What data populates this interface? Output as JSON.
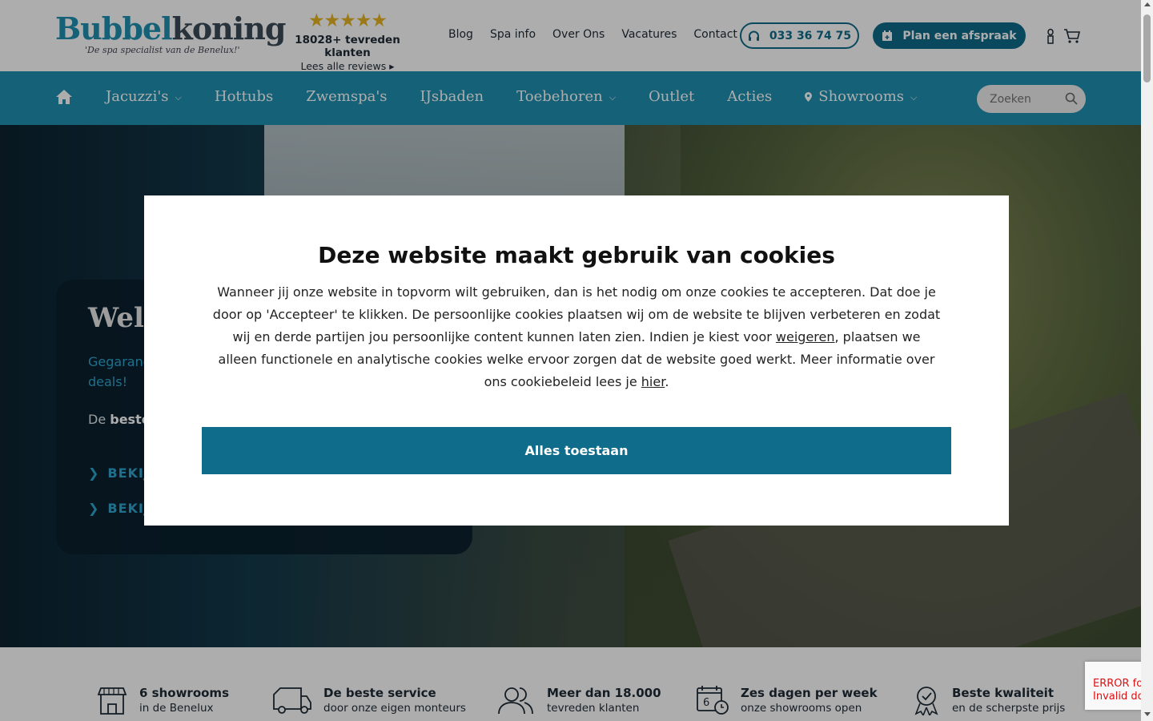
{
  "logo": {
    "part1": "Bubbel",
    "part2": "koning",
    "tagline": "'De spa specialist van de Benelux!'"
  },
  "reviews": {
    "stars": "★★★★★",
    "count": "18028+ tevreden klanten",
    "link": "Lees alle reviews ▸"
  },
  "topnav": [
    "Blog",
    "Spa info",
    "Over Ons",
    "Vacatures",
    "Contact"
  ],
  "phone": "033 36 74 75",
  "appointment": "Plan een afspraak",
  "mainnav": [
    {
      "label": "Jacuzzi's",
      "dropdown": true
    },
    {
      "label": "Hottubs",
      "dropdown": false
    },
    {
      "label": "Zwemspa's",
      "dropdown": false
    },
    {
      "label": "IJsbaden",
      "dropdown": false
    },
    {
      "label": "Toebehoren",
      "dropdown": true
    },
    {
      "label": "Outlet",
      "dropdown": false
    },
    {
      "label": "Acties",
      "dropdown": false
    },
    {
      "label": "Showrooms",
      "dropdown": true
    }
  ],
  "search": {
    "placeholder": "Zoeken"
  },
  "hero": {
    "title": "Welk",
    "subtitle": "Gegaranc",
    "subtitle2": "deals!",
    "text_prefix": "De ",
    "text_bold": "beste",
    "link1": "BEKIJK",
    "link2": "BEKIJK"
  },
  "cookie": {
    "title": "Deze website maakt gebruik van cookies",
    "text1": "Wanneer jij onze website in topvorm wilt gebruiken, dan is het nodig om onze cookies te accepteren. Dat doe je door op 'Accepteer' te klikken. De persoonlijke cookies plaatsen wij om de website te blijven verbeteren en zodat wij en derde partijen jou persoonlijke content kunnen laten zien. Indien je kiest voor ",
    "refuse_link": "weigeren",
    "text2": ", plaatsen we alleen functionele en analytische cookies welke ervoor zorgen dat de website goed werkt. Meer informatie over ons cookiebeleid lees je ",
    "here_link": "hier",
    "text3": ".",
    "accept": "Alles toestaan"
  },
  "features": [
    {
      "title": "6 showrooms",
      "sub": "in de Benelux",
      "icon": "store-icon"
    },
    {
      "title": "De beste service",
      "sub": "door onze eigen monteurs",
      "icon": "van-icon"
    },
    {
      "title": "Meer dan 18.000",
      "sub": "tevreden klanten",
      "icon": "people-icon"
    },
    {
      "title": "Zes dagen per week",
      "sub": "onze showrooms open",
      "icon": "calendar-icon"
    },
    {
      "title": "Beste kwaliteit",
      "sub": "en de scherpste prijs",
      "icon": "award-icon"
    }
  ],
  "calendar_day": "6",
  "recaptcha": {
    "line1": "ERROR fo",
    "line2": "Invalid do"
  },
  "colors": {
    "brand_blue": "#1f8fb0",
    "dark_blue": "#0f6c8a",
    "star": "#e6b422"
  }
}
